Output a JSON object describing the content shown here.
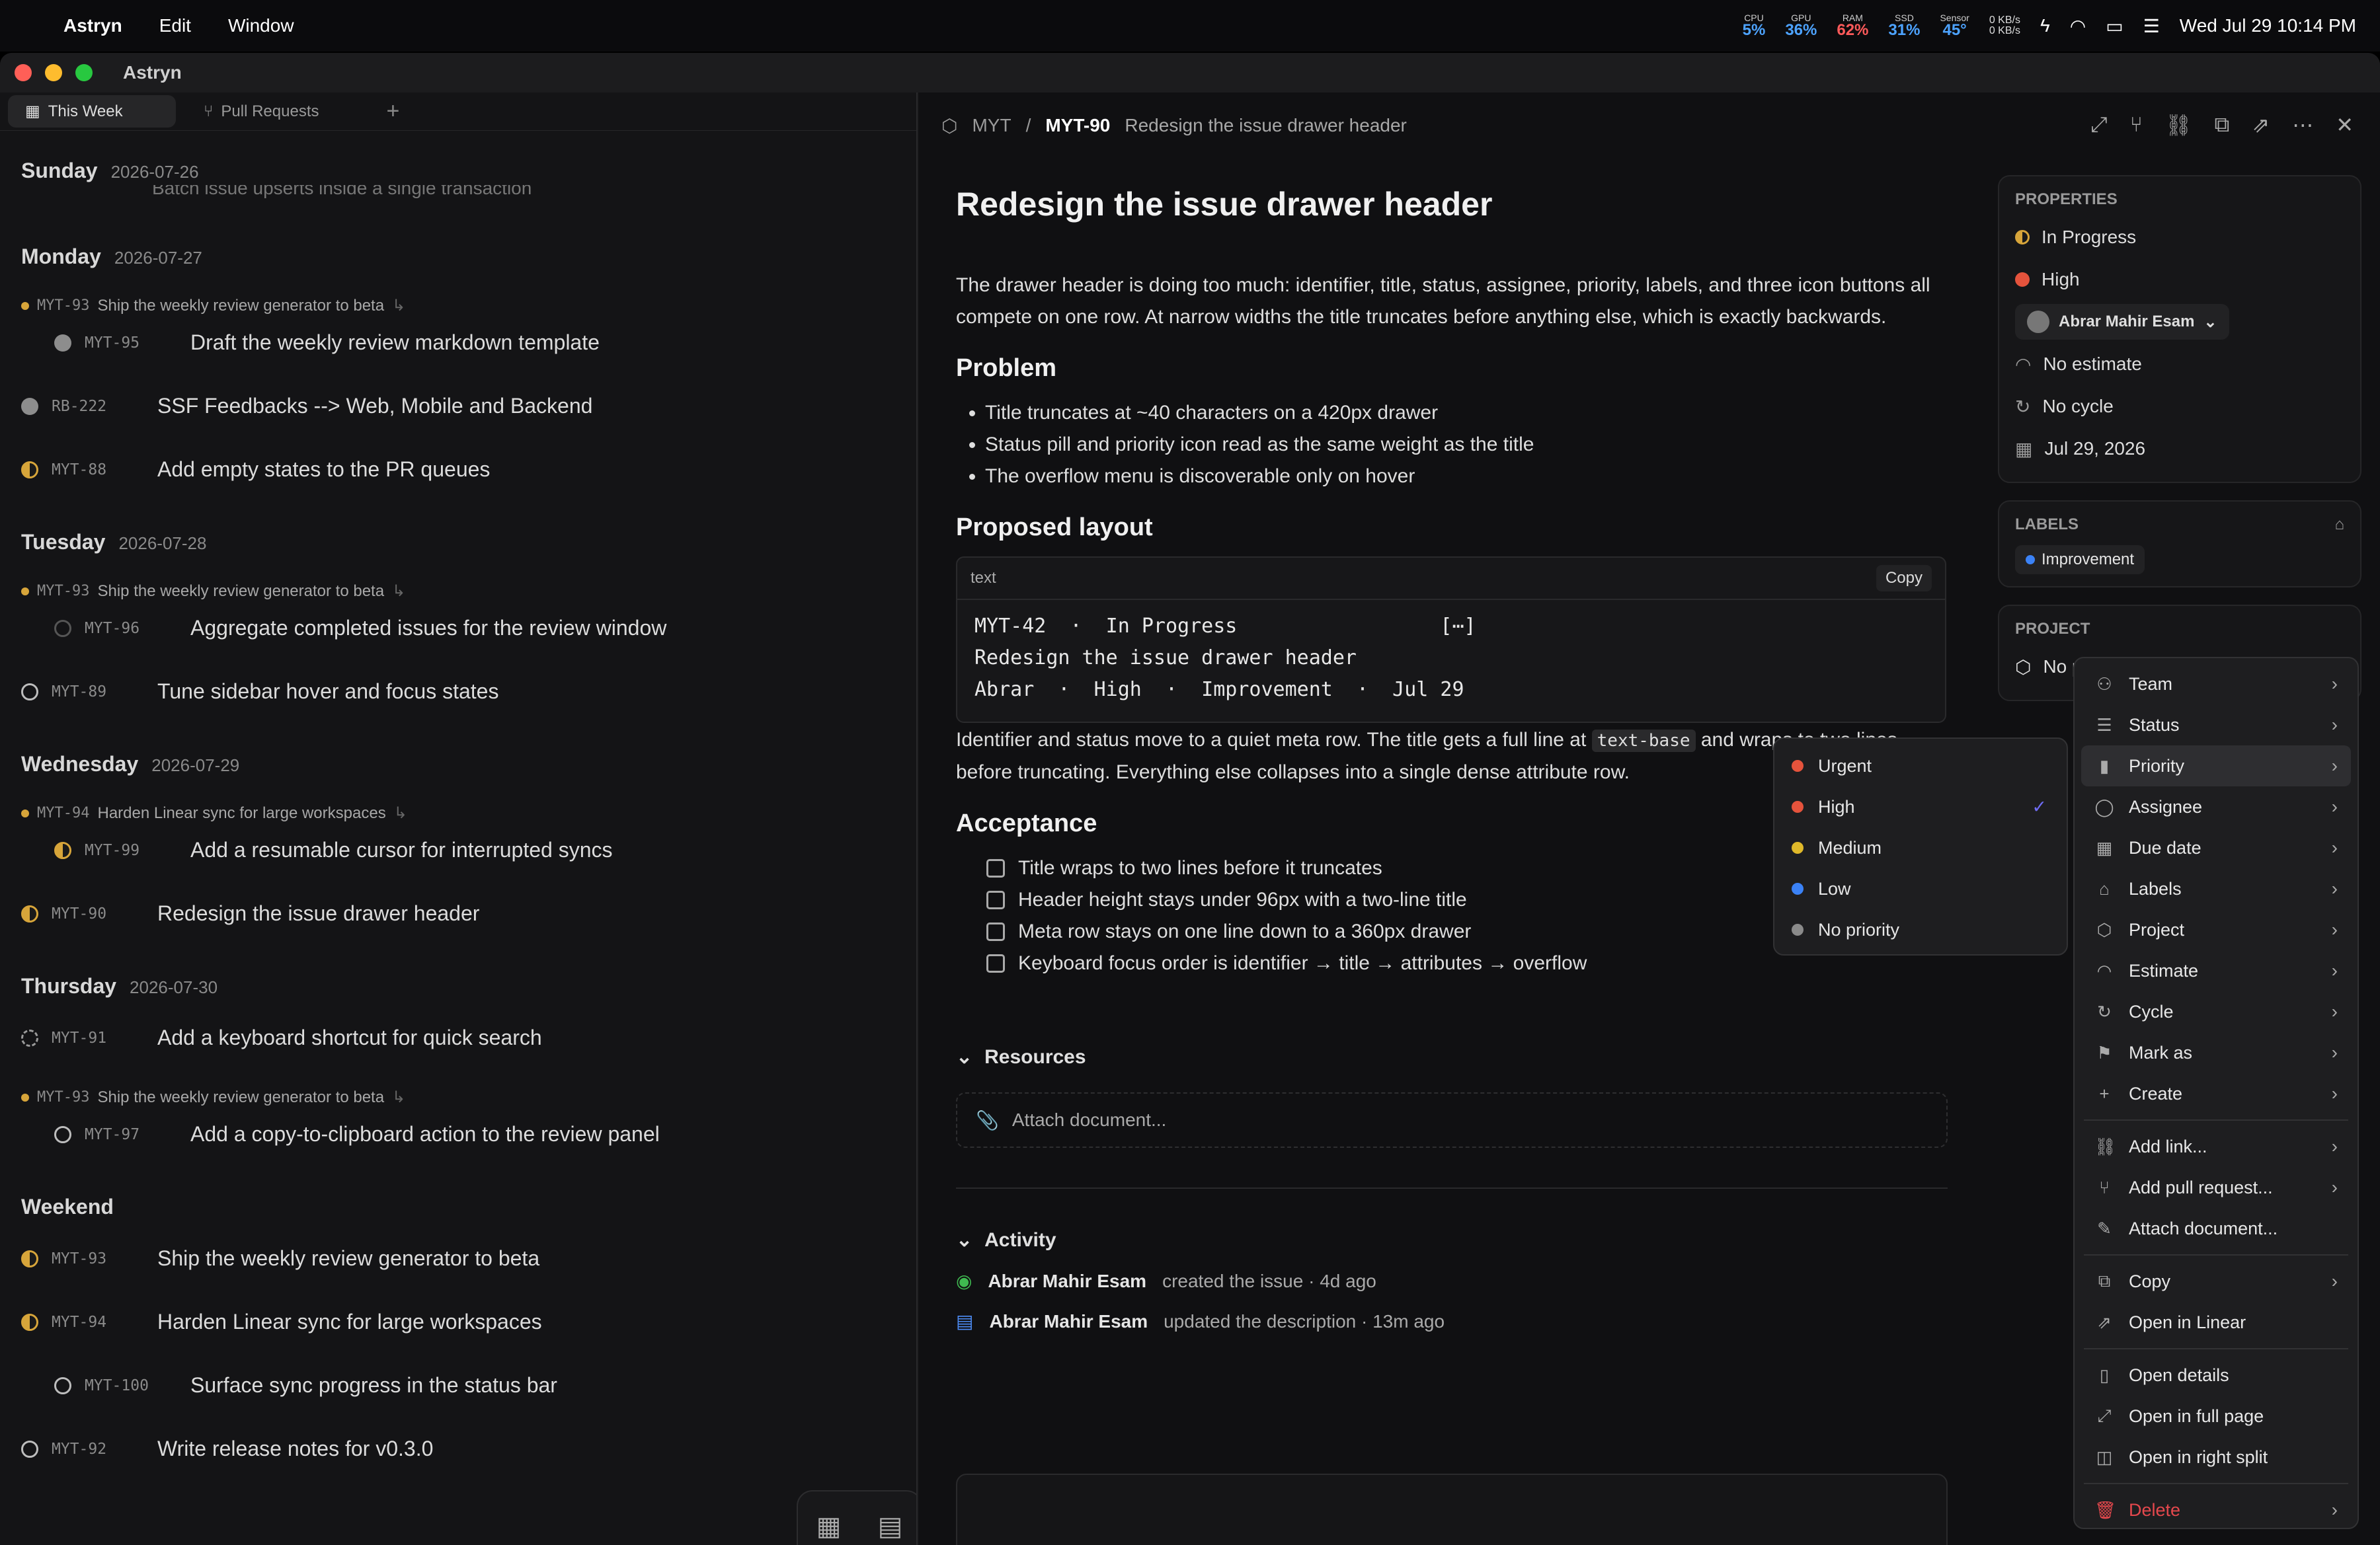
{
  "menubar": {
    "app": "Astryn",
    "menus": [
      "Edit",
      "Window"
    ],
    "stats": [
      {
        "label": "CPU",
        "value": "5%",
        "color": "#4da3ff"
      },
      {
        "label": "GPU",
        "value": "36%",
        "color": "#4da3ff"
      },
      {
        "label": "RAM",
        "value": "62%",
        "color": "#ff5a5a"
      },
      {
        "label": "SSD",
        "value": "31%",
        "color": "#4da3ff"
      },
      {
        "label": "Sensor",
        "value": "45°",
        "color": "#4da3ff"
      }
    ],
    "net_up": "0 KB/s",
    "net_down": "0 KB/s",
    "clock": "Wed Jul 29  10:14 PM"
  },
  "window": {
    "title": "Astryn"
  },
  "tabs": {
    "week": "This Week",
    "prs": "Pull Requests",
    "add": "+"
  },
  "days": [
    {
      "name": "Sunday",
      "date": "2026-07-26"
    },
    {
      "name": "Monday",
      "date": "2026-07-27"
    },
    {
      "name": "Tuesday",
      "date": "2026-07-28"
    },
    {
      "name": "Wednesday",
      "date": "2026-07-29"
    },
    {
      "name": "Thursday",
      "date": "2026-07-30"
    },
    {
      "name": "Weekend",
      "date": ""
    }
  ],
  "sunday_partial": "Batch issue upserts inside a single transaction",
  "parents": {
    "p1": {
      "id": "MYT-93",
      "title": "Ship the weekly review generator to beta"
    },
    "p2": {
      "id": "MYT-93",
      "title": "Ship the weekly review generator to beta"
    },
    "p3": {
      "id": "MYT-94",
      "title": "Harden Linear sync for large workspaces"
    },
    "p4": {
      "id": "MYT-93",
      "title": "Ship the weekly review generator to beta"
    }
  },
  "issues": {
    "i1": {
      "id": "MYT-95",
      "title": "Draft the weekly review markdown template"
    },
    "i2": {
      "id": "RB-222",
      "title": "SSF Feedbacks --> Web, Mobile and Backend"
    },
    "i3": {
      "id": "MYT-88",
      "title": "Add empty states to the PR queues"
    },
    "i4": {
      "id": "MYT-96",
      "title": "Aggregate completed issues for the review window"
    },
    "i5": {
      "id": "MYT-89",
      "title": "Tune sidebar hover and focus states"
    },
    "i6": {
      "id": "MYT-99",
      "title": "Add a resumable cursor for interrupted syncs"
    },
    "i7": {
      "id": "MYT-90",
      "title": "Redesign the issue drawer header"
    },
    "i8": {
      "id": "MYT-91",
      "title": "Add a keyboard shortcut for quick search"
    },
    "i9": {
      "id": "MYT-97",
      "title": "Add a copy-to-clipboard action to the review panel"
    },
    "i10": {
      "id": "MYT-93",
      "title": "Ship the weekly review generator to beta"
    },
    "i11": {
      "id": "MYT-94",
      "title": "Harden Linear sync for large workspaces"
    },
    "i12": {
      "id": "MYT-100",
      "title": "Surface sync progress in the status bar"
    },
    "i13": {
      "id": "MYT-92",
      "title": "Write release notes for v0.3.0"
    }
  },
  "drawer": {
    "team": "MYT",
    "key": "MYT-90",
    "title": "Redesign the issue drawer header",
    "heading": "Redesign the issue drawer header",
    "intro": "The drawer header is doing too much: identifier, title, status, assignee, priority, labels, and three icon buttons all compete on one row. At narrow widths the title truncates before anything else, which is exactly backwards.",
    "problem_h": "Problem",
    "problems": [
      "Title truncates at ~40 characters on a 420px drawer",
      "Status pill and priority icon read as the same weight as the title",
      "The overflow menu is discoverable only on hover"
    ],
    "layout_h": "Proposed layout",
    "code_lang": "text",
    "copy": "Copy",
    "code": "MYT-42  ·  In Progress                 [⋯]\nRedesign the issue drawer header\nAbrar  ·  High  ·  Improvement  ·  Jul 29",
    "after_code_1": "Identifier and status move to a quiet meta row. The title gets a full line at ",
    "inline_code": "text-base",
    "after_code_2": " and wraps to two lines before truncating. Everything else collapses into a single dense attribute row.",
    "acceptance_h": "Acceptance",
    "acceptance": [
      "Title wraps to two lines before it truncates",
      "Header height stays under 96px with a two-line title",
      "Meta row stays on one line down to a 360px drawer",
      "Keyboard focus order is identifier → title → attributes → overflow"
    ],
    "resources_h": "Resources",
    "attach": "Attach document...",
    "activity_h": "Activity",
    "activity": [
      {
        "user": "Abrar Mahir Esam",
        "text": "created the issue · 4d ago"
      },
      {
        "user": "Abrar Mahir Esam",
        "text": "updated the description · 13m ago"
      }
    ]
  },
  "props": {
    "header": "PROPERTIES",
    "status": "In Progress",
    "priority": "High",
    "assignee": "Abrar Mahir Esam",
    "estimate": "No estimate",
    "cycle": "No cycle",
    "due": "Jul 29, 2026",
    "labels_h": "LABELS",
    "label": "Improvement",
    "project_h": "PROJECT",
    "project": "No project"
  },
  "priority_menu": [
    {
      "label": "Urgent",
      "color": "#e5533c"
    },
    {
      "label": "High",
      "color": "#e5533c",
      "checked": true
    },
    {
      "label": "Medium",
      "color": "#e0b92a"
    },
    {
      "label": "Low",
      "color": "#3b82f6"
    },
    {
      "label": "No priority",
      "color": "#8a8a8a"
    }
  ],
  "context_menu": {
    "team": "Team",
    "status": "Status",
    "priority": "Priority",
    "assignee": "Assignee",
    "due": "Due date",
    "labels": "Labels",
    "project": "Project",
    "estimate": "Estimate",
    "cycle": "Cycle",
    "mark": "Mark as",
    "create": "Create",
    "add_link": "Add link...",
    "add_pr": "Add pull request...",
    "attach": "Attach document...",
    "copy": "Copy",
    "open_linear": "Open in Linear",
    "open_details": "Open details",
    "open_full": "Open in full page",
    "open_split": "Open in right split",
    "delete": "Delete"
  }
}
